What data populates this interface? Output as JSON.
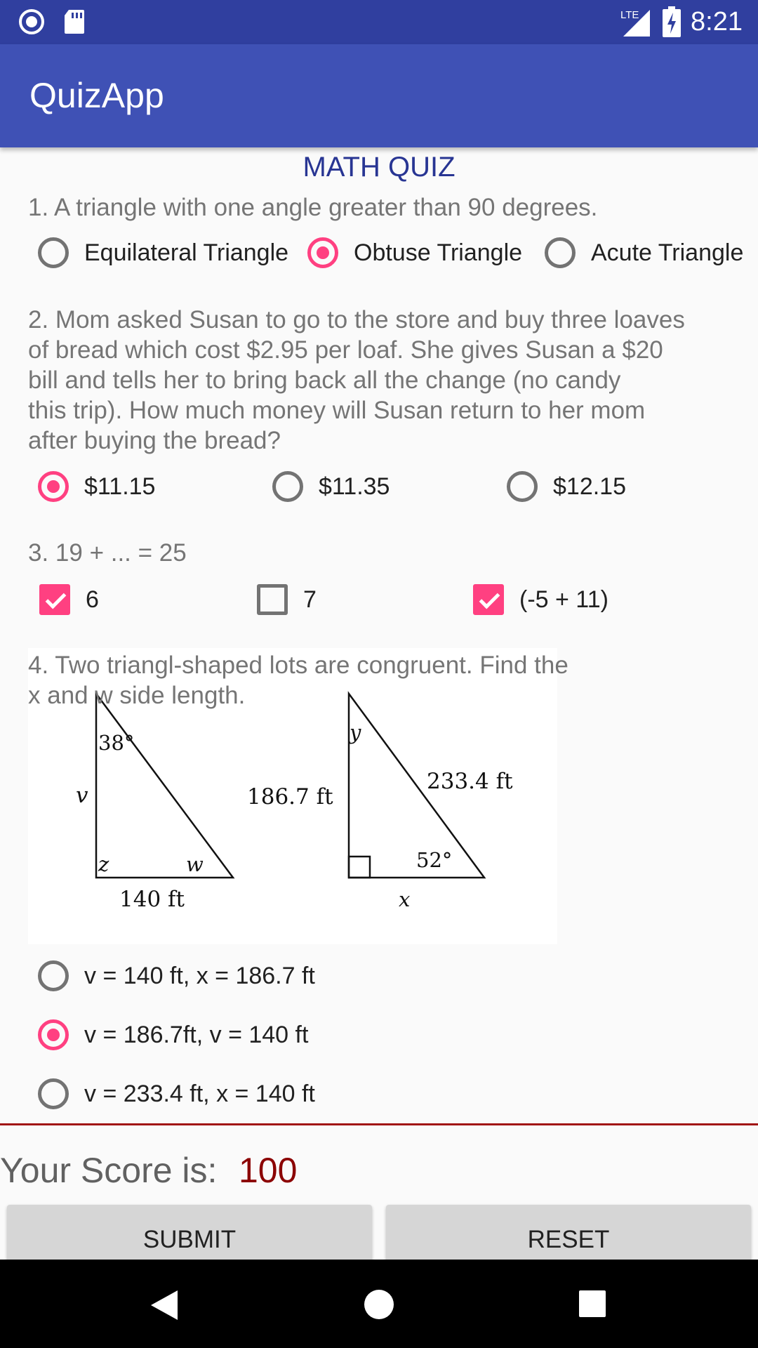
{
  "status_bar": {
    "time": "8:21",
    "network": "LTE",
    "icons": [
      "notification-circle-icon",
      "sd-card-icon",
      "signal-lte-icon",
      "battery-charging-icon"
    ]
  },
  "app_bar": {
    "title": "QuizApp"
  },
  "quiz": {
    "title": "MATH QUIZ",
    "q1": {
      "text": "1. A triangle with one angle greater than 90 degrees.",
      "options": [
        {
          "label": "Equilateral Triangle",
          "selected": false
        },
        {
          "label": "Obtuse Triangle",
          "selected": true
        },
        {
          "label": "Acute Triangle",
          "selected": false
        }
      ]
    },
    "q2": {
      "lines": [
        "2. Mom asked Susan to go to the store and buy three loaves",
        "of bread which cost $2.95 per loaf. She gives Susan a $20",
        "bill and tells her to bring back all the change (no candy",
        "this trip). How much money will Susan return to her mom",
        "after buying the bread?"
      ],
      "options": [
        {
          "label": "$11.15",
          "selected": true
        },
        {
          "label": "$11.35",
          "selected": false
        },
        {
          "label": "$12.15",
          "selected": false
        }
      ]
    },
    "q3": {
      "text": "3. 19 + ... = 25",
      "options": [
        {
          "label": "6",
          "checked": true
        },
        {
          "label": "7",
          "checked": false
        },
        {
          "label": "(-5 + 11)",
          "checked": true
        }
      ]
    },
    "q4": {
      "lines": [
        "4. Two triangl-shaped lots are congruent. Find the",
        "x and w side length."
      ],
      "figure": {
        "left": {
          "angle_top": "38°",
          "side_left": "v",
          "angle_bottom_left": "z",
          "angle_bottom_right": "w",
          "base": "140 ft"
        },
        "right": {
          "angle_top": "y",
          "side_left": "186.7 ft",
          "hypotenuse": "233.4 ft",
          "angle_bottom_right": "52°",
          "base": "x"
        }
      },
      "options": [
        {
          "label": "v = 140 ft, x = 186.7 ft",
          "selected": false
        },
        {
          "label": "v = 186.7ft, v = 140 ft",
          "selected": true
        },
        {
          "label": "v = 233.4 ft, x = 140 ft",
          "selected": false
        }
      ]
    }
  },
  "score": {
    "label": "Your Score is:",
    "value": "100"
  },
  "buttons": {
    "submit": "SUBMIT",
    "reset": "RESET"
  },
  "nav": {
    "icons": [
      "back-icon",
      "home-icon",
      "recents-icon"
    ]
  },
  "colors": {
    "primary": "#3f51b5",
    "primary_dark": "#303f9f",
    "accent": "#ff4081",
    "score": "#8b0000"
  }
}
